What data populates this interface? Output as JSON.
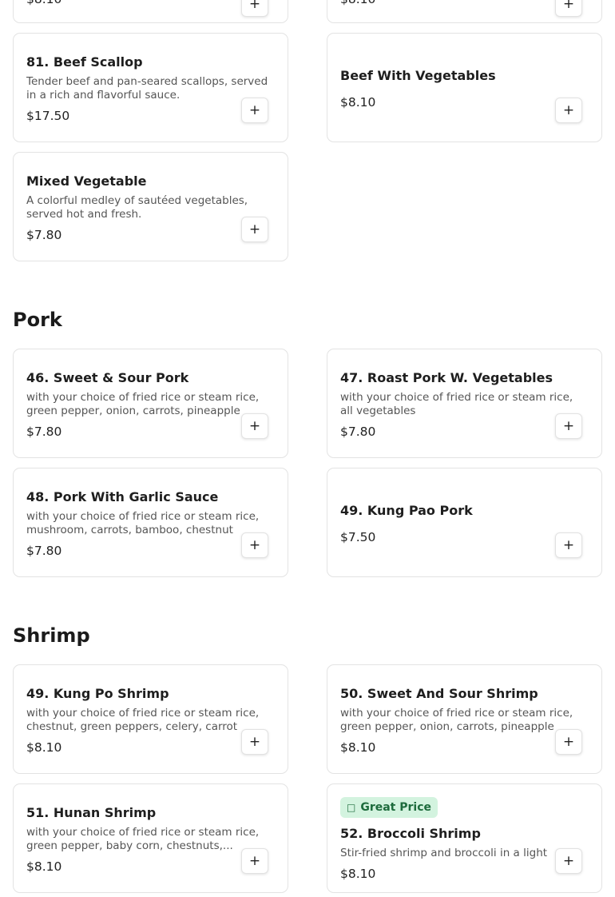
{
  "top_partial": {
    "left_price": "$8.10",
    "right_price": "$8.10"
  },
  "beef": {
    "items": [
      {
        "name": "81. Beef Scallop",
        "desc": "Tender beef and pan-seared scallops, served in a rich and flavorful sauce.",
        "price": "$17.50"
      },
      {
        "name": "Beef With Vegetables",
        "desc": "",
        "price": "$8.10"
      },
      {
        "name": "Mixed Vegetable",
        "desc": "A colorful medley of sautéed vegetables, served hot and fresh.",
        "price": "$7.80"
      }
    ]
  },
  "pork": {
    "title": "Pork",
    "items": [
      {
        "name": "46. Sweet & Sour Pork",
        "desc": "with your choice of fried rice or steam rice, green pepper, onion, carrots, pineapple",
        "price": "$7.80"
      },
      {
        "name": "47. Roast Pork W. Vegetables",
        "desc": "with your choice of fried rice or steam rice, all vegetables",
        "price": "$7.80"
      },
      {
        "name": "48. Pork With Garlic Sauce",
        "desc": "with your choice of fried rice or steam rice, mushroom, carrots, bamboo, chestnut",
        "price": "$7.80"
      },
      {
        "name": "49. Kung Pao Pork",
        "desc": "",
        "price": "$7.50"
      }
    ]
  },
  "shrimp": {
    "title": "Shrimp",
    "items": [
      {
        "name": "49. Kung Po Shrimp",
        "desc": "with your choice of fried rice or steam rice, chestnut, green peppers, celery, carrot",
        "price": "$8.10"
      },
      {
        "name": "50. Sweet And Sour Shrimp",
        "desc": "with your choice of fried rice or steam rice, green pepper, onion, carrots, pineapple",
        "price": "$8.10"
      },
      {
        "name": "51. Hunan Shrimp",
        "desc": "with your choice of fried rice or steam rice, green pepper, baby corn, chestnuts,...",
        "price": "$8.10"
      },
      {
        "name": "52. Broccoli Shrimp",
        "desc": "Stir-fried shrimp and broccoli in a light",
        "price": "$8.10",
        "badge": "Great Price"
      }
    ]
  },
  "add_label": "+",
  "colors": {
    "badge_bg": "#d3f3df",
    "badge_text": "#1d6b3c"
  },
  "icons": {
    "add": "plus-icon",
    "badge": "tag-icon"
  }
}
